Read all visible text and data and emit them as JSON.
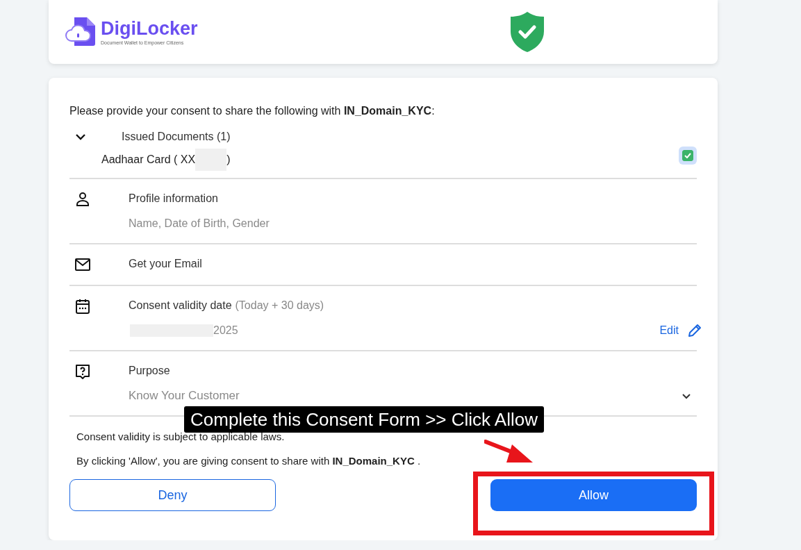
{
  "header": {
    "logo": {
      "name": "DigiLocker",
      "tagline": "Document Wallet to Empower Citizens"
    }
  },
  "consent": {
    "intro": "Please provide your consent to share the following with **IN_Domain_KYC**:",
    "documents": {
      "title": "Issued Documents (1)",
      "expanded": true,
      "items": [
        {
          "label": "Aadhaar Card ( XX",
          "suffix": ")",
          "checked": true
        }
      ]
    },
    "sections": [
      {
        "kind": "profile",
        "title": "Profile information",
        "detail": "Name, Date of Birth, Gender"
      },
      {
        "kind": "email",
        "title": "Get your Email"
      },
      {
        "kind": "validity",
        "title": "Consent validity date",
        "note": "(Today + 30 days)",
        "detail": "2025",
        "action": "Edit"
      },
      {
        "kind": "purpose",
        "title": "Purpose",
        "detail": "Know Your Customer"
      }
    ],
    "notes": [
      "Consent validity is subject to applicable laws.",
      "By clicking 'Allow', you are giving consent to share with **IN_Domain_KYC** ."
    ],
    "buttons": [
      {
        "label": "Deny",
        "kind": "secondary"
      },
      {
        "label": "Allow",
        "kind": "primary"
      }
    ]
  },
  "annotation": {
    "text": "Complete this Consent Form >> Click Allow"
  }
}
